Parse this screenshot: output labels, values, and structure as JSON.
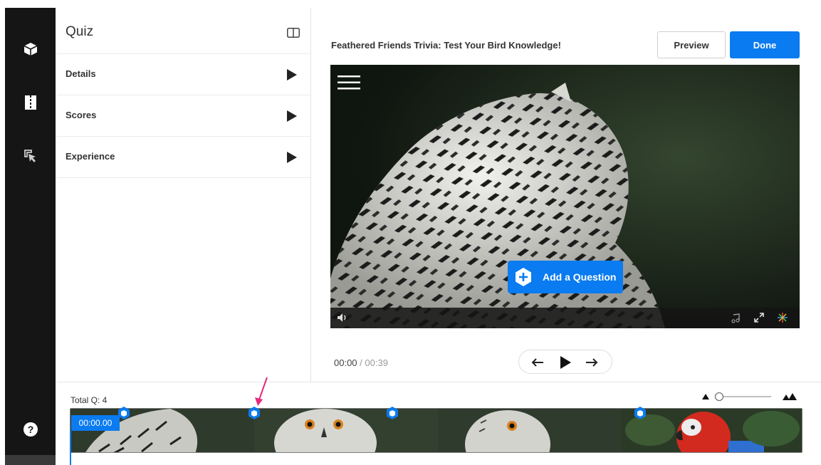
{
  "sidebar": {
    "icons": [
      "cube-icon",
      "chapters-icon",
      "pointer-icon"
    ],
    "help_icon": "help-icon"
  },
  "panel": {
    "title": "Quiz",
    "sections": [
      {
        "label": "Details"
      },
      {
        "label": "Scores"
      },
      {
        "label": "Experience"
      }
    ]
  },
  "header": {
    "quiz_title": "Feathered Friends Trivia: Test Your Bird Knowledge!",
    "preview_label": "Preview",
    "done_label": "Done"
  },
  "player": {
    "add_question_label": "Add a Question",
    "current_time": "00:00",
    "separator": " / ",
    "duration": "00:39"
  },
  "timeline": {
    "total_label": "Total Q: 4",
    "timecode": "00:00.00",
    "question_count": 4
  },
  "colors": {
    "accent": "#0a7bf0",
    "sidebar_bg": "#151515",
    "pointer_arrow": "#e6287a"
  }
}
